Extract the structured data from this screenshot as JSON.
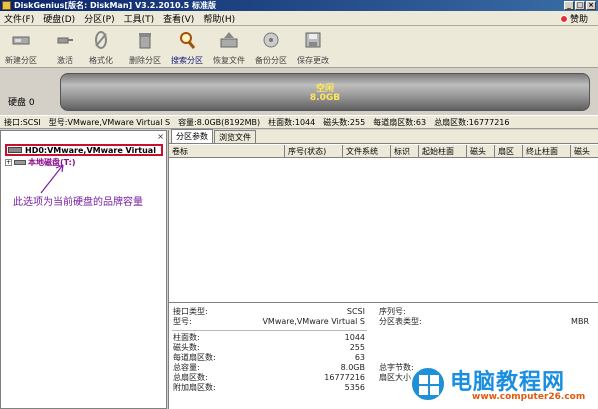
{
  "window": {
    "title": "DiskGenius[版名: DiskMan] V3.2.2010.5 标准版"
  },
  "menu": {
    "items": [
      "文件(F)",
      "硬盘(D)",
      "分区(P)",
      "工具(T)",
      "查看(V)",
      "帮助(H)"
    ],
    "help": "赞助"
  },
  "toolbar": {
    "buttons": [
      {
        "label": "新建分区",
        "icon": "new-partition-icon"
      },
      {
        "label": "激活",
        "icon": "activate-icon"
      },
      {
        "label": "格式化",
        "icon": "format-icon"
      },
      {
        "label": "删除分区",
        "icon": "delete-partition-icon"
      },
      {
        "label": "搜索分区",
        "icon": "search-partition-icon"
      },
      {
        "label": "恢复文件",
        "icon": "recover-files-icon"
      },
      {
        "label": "备份分区",
        "icon": "backup-partition-icon"
      },
      {
        "label": "保存更改",
        "icon": "save-changes-icon"
      }
    ]
  },
  "disk": {
    "label": "硬盘 0",
    "bar_line1": "空闲",
    "bar_line2": "8.0GB"
  },
  "info": {
    "interface": "接口:SCSI",
    "model": "型号:VMware,VMware Virtual S",
    "capacity": "容量:8.0GB(8192MB)",
    "cylinders": "柱面数:1044",
    "heads": "磁头数:255",
    "sectors_per_track": "每道扇区数:63",
    "total_sectors": "总扇区数:16777216"
  },
  "tree": {
    "disk_item": "HD0:VMware,VMware Virtual",
    "local_disk": "本地磁盘(T:)",
    "annotation": "此选项为当前硬盘的品牌容量"
  },
  "tabs": [
    "分区参数",
    "浏览文件"
  ],
  "table": {
    "columns": [
      "卷标",
      "序号(状态)",
      "文件系统",
      "标识",
      "起始柱面",
      "磁头",
      "扇区",
      "终止柱面",
      "磁头"
    ]
  },
  "details": {
    "interface_type_label": "接口类型:",
    "interface_type_value": "SCSI",
    "serial_label": "序列号:",
    "model_label": "型号:",
    "model_value": "VMware,VMware Virtual S",
    "partition_table_label": "分区表类型:",
    "partition_table_value": "MBR",
    "cylinders_label": "柱面数:",
    "cylinders_value": "1044",
    "heads_label": "磁头数:",
    "heads_value": "255",
    "spt_label": "每道扇区数:",
    "spt_value": "63",
    "total_capacity_label": "总容量:",
    "total_capacity_value": "8.0GB",
    "total_bytes_label": "总字节数:",
    "total_sectors_label": "总扇区数:",
    "total_sectors_value": "16777216",
    "sector_size_label": "扇区大小:",
    "extra_sectors_label": "附加扇区数:",
    "extra_sectors_value": "5356"
  },
  "watermark": {
    "title": "电脑教程网",
    "url": "www.computer26.com"
  }
}
